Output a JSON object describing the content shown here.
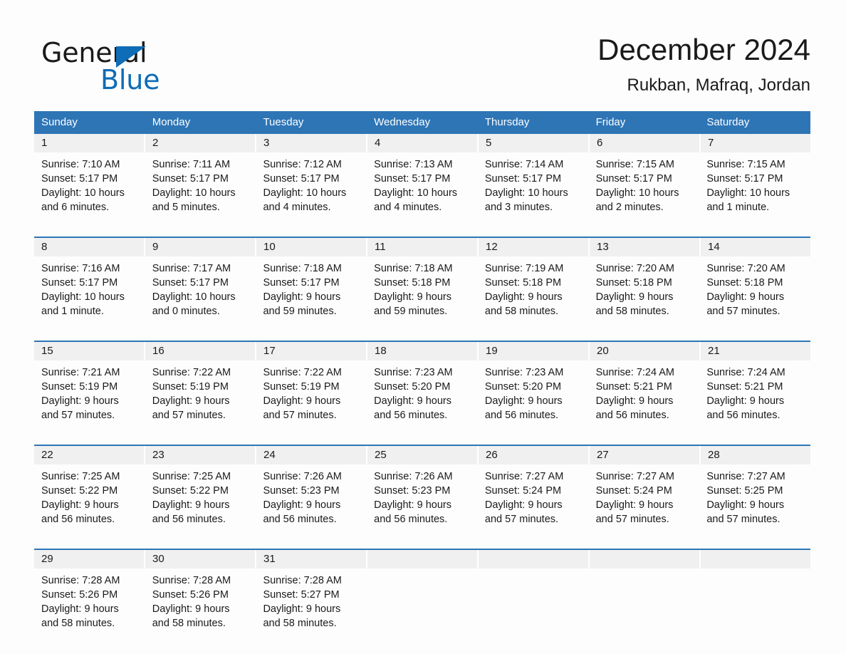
{
  "brand": {
    "name_part1": "General",
    "name_part2": "Blue",
    "logo_icon": "triangle-flag-icon",
    "accent_color": "#0f6cb6"
  },
  "header": {
    "month_title": "December 2024",
    "location": "Rukban, Mafraq, Jordan"
  },
  "calendar": {
    "header_color": "#2e75b6",
    "daynum_band_color": "#f0f0f0",
    "weekday_headers": [
      "Sunday",
      "Monday",
      "Tuesday",
      "Wednesday",
      "Thursday",
      "Friday",
      "Saturday"
    ],
    "weeks": [
      {
        "days": [
          {
            "number": "1",
            "sunrise": "Sunrise: 7:10 AM",
            "sunset": "Sunset: 5:17 PM",
            "daylight_line1": "Daylight: 10 hours",
            "daylight_line2": "and 6 minutes."
          },
          {
            "number": "2",
            "sunrise": "Sunrise: 7:11 AM",
            "sunset": "Sunset: 5:17 PM",
            "daylight_line1": "Daylight: 10 hours",
            "daylight_line2": "and 5 minutes."
          },
          {
            "number": "3",
            "sunrise": "Sunrise: 7:12 AM",
            "sunset": "Sunset: 5:17 PM",
            "daylight_line1": "Daylight: 10 hours",
            "daylight_line2": "and 4 minutes."
          },
          {
            "number": "4",
            "sunrise": "Sunrise: 7:13 AM",
            "sunset": "Sunset: 5:17 PM",
            "daylight_line1": "Daylight: 10 hours",
            "daylight_line2": "and 4 minutes."
          },
          {
            "number": "5",
            "sunrise": "Sunrise: 7:14 AM",
            "sunset": "Sunset: 5:17 PM",
            "daylight_line1": "Daylight: 10 hours",
            "daylight_line2": "and 3 minutes."
          },
          {
            "number": "6",
            "sunrise": "Sunrise: 7:15 AM",
            "sunset": "Sunset: 5:17 PM",
            "daylight_line1": "Daylight: 10 hours",
            "daylight_line2": "and 2 minutes."
          },
          {
            "number": "7",
            "sunrise": "Sunrise: 7:15 AM",
            "sunset": "Sunset: 5:17 PM",
            "daylight_line1": "Daylight: 10 hours",
            "daylight_line2": "and 1 minute."
          }
        ]
      },
      {
        "days": [
          {
            "number": "8",
            "sunrise": "Sunrise: 7:16 AM",
            "sunset": "Sunset: 5:17 PM",
            "daylight_line1": "Daylight: 10 hours",
            "daylight_line2": "and 1 minute."
          },
          {
            "number": "9",
            "sunrise": "Sunrise: 7:17 AM",
            "sunset": "Sunset: 5:17 PM",
            "daylight_line1": "Daylight: 10 hours",
            "daylight_line2": "and 0 minutes."
          },
          {
            "number": "10",
            "sunrise": "Sunrise: 7:18 AM",
            "sunset": "Sunset: 5:17 PM",
            "daylight_line1": "Daylight: 9 hours",
            "daylight_line2": "and 59 minutes."
          },
          {
            "number": "11",
            "sunrise": "Sunrise: 7:18 AM",
            "sunset": "Sunset: 5:18 PM",
            "daylight_line1": "Daylight: 9 hours",
            "daylight_line2": "and 59 minutes."
          },
          {
            "number": "12",
            "sunrise": "Sunrise: 7:19 AM",
            "sunset": "Sunset: 5:18 PM",
            "daylight_line1": "Daylight: 9 hours",
            "daylight_line2": "and 58 minutes."
          },
          {
            "number": "13",
            "sunrise": "Sunrise: 7:20 AM",
            "sunset": "Sunset: 5:18 PM",
            "daylight_line1": "Daylight: 9 hours",
            "daylight_line2": "and 58 minutes."
          },
          {
            "number": "14",
            "sunrise": "Sunrise: 7:20 AM",
            "sunset": "Sunset: 5:18 PM",
            "daylight_line1": "Daylight: 9 hours",
            "daylight_line2": "and 57 minutes."
          }
        ]
      },
      {
        "days": [
          {
            "number": "15",
            "sunrise": "Sunrise: 7:21 AM",
            "sunset": "Sunset: 5:19 PM",
            "daylight_line1": "Daylight: 9 hours",
            "daylight_line2": "and 57 minutes."
          },
          {
            "number": "16",
            "sunrise": "Sunrise: 7:22 AM",
            "sunset": "Sunset: 5:19 PM",
            "daylight_line1": "Daylight: 9 hours",
            "daylight_line2": "and 57 minutes."
          },
          {
            "number": "17",
            "sunrise": "Sunrise: 7:22 AM",
            "sunset": "Sunset: 5:19 PM",
            "daylight_line1": "Daylight: 9 hours",
            "daylight_line2": "and 57 minutes."
          },
          {
            "number": "18",
            "sunrise": "Sunrise: 7:23 AM",
            "sunset": "Sunset: 5:20 PM",
            "daylight_line1": "Daylight: 9 hours",
            "daylight_line2": "and 56 minutes."
          },
          {
            "number": "19",
            "sunrise": "Sunrise: 7:23 AM",
            "sunset": "Sunset: 5:20 PM",
            "daylight_line1": "Daylight: 9 hours",
            "daylight_line2": "and 56 minutes."
          },
          {
            "number": "20",
            "sunrise": "Sunrise: 7:24 AM",
            "sunset": "Sunset: 5:21 PM",
            "daylight_line1": "Daylight: 9 hours",
            "daylight_line2": "and 56 minutes."
          },
          {
            "number": "21",
            "sunrise": "Sunrise: 7:24 AM",
            "sunset": "Sunset: 5:21 PM",
            "daylight_line1": "Daylight: 9 hours",
            "daylight_line2": "and 56 minutes."
          }
        ]
      },
      {
        "days": [
          {
            "number": "22",
            "sunrise": "Sunrise: 7:25 AM",
            "sunset": "Sunset: 5:22 PM",
            "daylight_line1": "Daylight: 9 hours",
            "daylight_line2": "and 56 minutes."
          },
          {
            "number": "23",
            "sunrise": "Sunrise: 7:25 AM",
            "sunset": "Sunset: 5:22 PM",
            "daylight_line1": "Daylight: 9 hours",
            "daylight_line2": "and 56 minutes."
          },
          {
            "number": "24",
            "sunrise": "Sunrise: 7:26 AM",
            "sunset": "Sunset: 5:23 PM",
            "daylight_line1": "Daylight: 9 hours",
            "daylight_line2": "and 56 minutes."
          },
          {
            "number": "25",
            "sunrise": "Sunrise: 7:26 AM",
            "sunset": "Sunset: 5:23 PM",
            "daylight_line1": "Daylight: 9 hours",
            "daylight_line2": "and 56 minutes."
          },
          {
            "number": "26",
            "sunrise": "Sunrise: 7:27 AM",
            "sunset": "Sunset: 5:24 PM",
            "daylight_line1": "Daylight: 9 hours",
            "daylight_line2": "and 57 minutes."
          },
          {
            "number": "27",
            "sunrise": "Sunrise: 7:27 AM",
            "sunset": "Sunset: 5:24 PM",
            "daylight_line1": "Daylight: 9 hours",
            "daylight_line2": "and 57 minutes."
          },
          {
            "number": "28",
            "sunrise": "Sunrise: 7:27 AM",
            "sunset": "Sunset: 5:25 PM",
            "daylight_line1": "Daylight: 9 hours",
            "daylight_line2": "and 57 minutes."
          }
        ]
      },
      {
        "days": [
          {
            "number": "29",
            "sunrise": "Sunrise: 7:28 AM",
            "sunset": "Sunset: 5:26 PM",
            "daylight_line1": "Daylight: 9 hours",
            "daylight_line2": "and 58 minutes."
          },
          {
            "number": "30",
            "sunrise": "Sunrise: 7:28 AM",
            "sunset": "Sunset: 5:26 PM",
            "daylight_line1": "Daylight: 9 hours",
            "daylight_line2": "and 58 minutes."
          },
          {
            "number": "31",
            "sunrise": "Sunrise: 7:28 AM",
            "sunset": "Sunset: 5:27 PM",
            "daylight_line1": "Daylight: 9 hours",
            "daylight_line2": "and 58 minutes."
          },
          {
            "number": "",
            "sunrise": "",
            "sunset": "",
            "daylight_line1": "",
            "daylight_line2": ""
          },
          {
            "number": "",
            "sunrise": "",
            "sunset": "",
            "daylight_line1": "",
            "daylight_line2": ""
          },
          {
            "number": "",
            "sunrise": "",
            "sunset": "",
            "daylight_line1": "",
            "daylight_line2": ""
          },
          {
            "number": "",
            "sunrise": "",
            "sunset": "",
            "daylight_line1": "",
            "daylight_line2": ""
          }
        ]
      }
    ]
  }
}
